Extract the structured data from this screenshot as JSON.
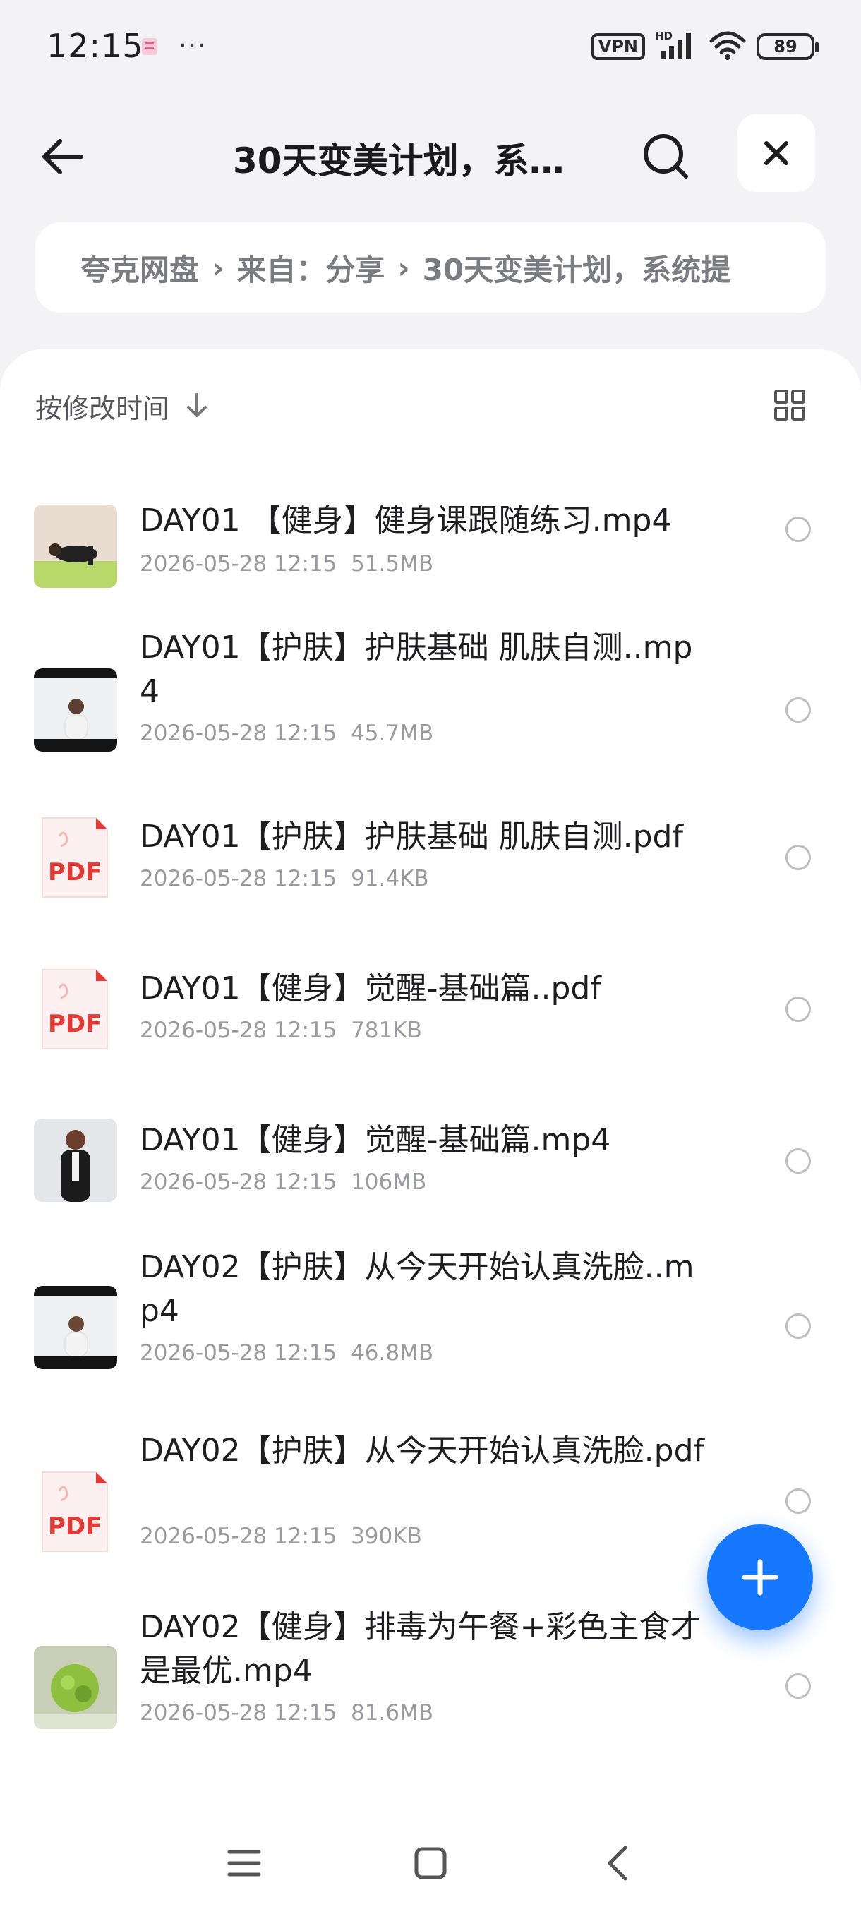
{
  "status_bar": {
    "time": "12:15",
    "dots": "···",
    "vpn": "VPN",
    "hd": "HD",
    "battery": "89"
  },
  "header": {
    "title": "30天变美计划，系…",
    "back_icon": "arrow-left-icon",
    "search_icon": "search-icon",
    "close_icon": "close-icon"
  },
  "breadcrumb": {
    "items": [
      "夸克网盘",
      "来自：分享",
      "30天变美计划，系统提"
    ],
    "separator": "›"
  },
  "toolbar": {
    "sort_label": "按修改时间",
    "sort_icon": "arrow-down-icon",
    "view_icon": "grid-view-icon"
  },
  "files": [
    {
      "name": "DAY01 【健身】健身课跟随练习.mp4",
      "date": "2026-05-28 12:15",
      "size": "51.5MB",
      "type": "video"
    },
    {
      "name": "DAY01【护肤】护肤基础 肌肤自测..mp4",
      "date": "2026-05-28 12:15",
      "size": "45.7MB",
      "type": "video"
    },
    {
      "name": "DAY01【护肤】护肤基础 肌肤自测.pdf",
      "date": "2026-05-28 12:15",
      "size": "91.4KB",
      "type": "pdf"
    },
    {
      "name": "DAY01【健身】觉醒-基础篇..pdf",
      "date": "2026-05-28 12:15",
      "size": "781KB",
      "type": "pdf"
    },
    {
      "name": "DAY01【健身】觉醒-基础篇.mp4",
      "date": "2026-05-28 12:15",
      "size": "106MB",
      "type": "video"
    },
    {
      "name": "DAY02【护肤】从今天开始认真洗脸..mp4",
      "date": "2026-05-28 12:15",
      "size": "46.8MB",
      "type": "video"
    },
    {
      "name": "DAY02【护肤】从今天开始认真洗脸.pdf",
      "date": "2026-05-28 12:15",
      "size": "390KB",
      "type": "pdf"
    },
    {
      "name": "DAY02【健身】排毒为午餐+彩色主食才是最优.mp4",
      "date": "2026-05-28 12:15",
      "size": "81.6MB",
      "type": "video"
    }
  ],
  "pdf_label": "PDF",
  "fab_icon": "plus-icon",
  "nav": {
    "menu_icon": "menu-icon",
    "home_icon": "home-square-icon",
    "back_icon": "nav-back-icon"
  },
  "colors": {
    "accent": "#1677ff",
    "pdf_red": "#e53935",
    "background": "#f3f3f5"
  }
}
